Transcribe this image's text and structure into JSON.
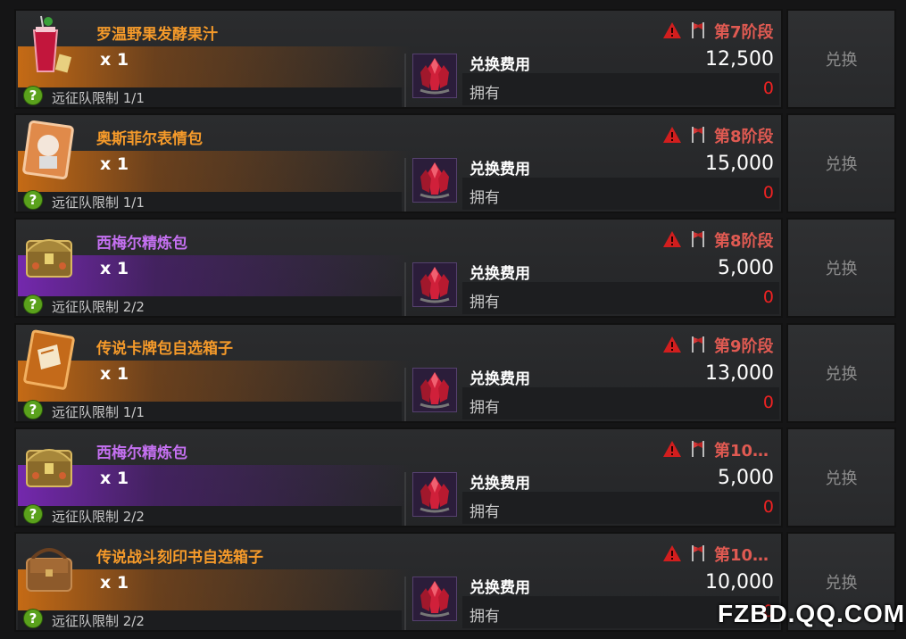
{
  "labels": {
    "cost": "兑换费用",
    "owned": "拥有",
    "exchange": "兑换",
    "help": "?"
  },
  "items": [
    {
      "name": "罗温野果发酵果汁",
      "qty": "x 1",
      "limit": "远征队限制 1/1",
      "cost": "12,500",
      "owned": "0",
      "stage": "第7阶段",
      "rarity": "orange",
      "icon": "juice-glass-icon"
    },
    {
      "name": "奥斯菲尔表情包",
      "qty": "x 1",
      "limit": "远征队限制 1/1",
      "cost": "15,000",
      "owned": "0",
      "stage": "第8阶段",
      "rarity": "orange",
      "icon": "emoticon-pack-icon"
    },
    {
      "name": "西梅尔精炼包",
      "qty": "x 1",
      "limit": "远征队限制 2/2",
      "cost": "5,000",
      "owned": "0",
      "stage": "第8阶段",
      "rarity": "purple",
      "icon": "treasure-chest-icon"
    },
    {
      "name": "传说卡牌包自选箱子",
      "qty": "x 1",
      "limit": "远征队限制 1/1",
      "cost": "13,000",
      "owned": "0",
      "stage": "第9阶段",
      "rarity": "orange",
      "icon": "card-book-icon"
    },
    {
      "name": "西梅尔精炼包",
      "qty": "x 1",
      "limit": "远征队限制 2/2",
      "cost": "5,000",
      "owned": "0",
      "stage": "第10…",
      "rarity": "purple",
      "icon": "treasure-chest-icon"
    },
    {
      "name": "传说战斗刻印书自选箱子",
      "qty": "x 1",
      "limit": "远征队限制 2/2",
      "cost": "10,000",
      "owned": "0",
      "stage": "第10…",
      "rarity": "orange",
      "icon": "leather-bag-icon"
    }
  ],
  "currency_icon": "red-crystal-icon",
  "colors": {
    "rarity_orange": "#f59a2a",
    "rarity_purple": "#c470f0",
    "stage_red": "#e05a52",
    "owned_red": "#ee2222",
    "help_green": "#5aa11c"
  },
  "watermark": "FZBD.QQ.COM"
}
